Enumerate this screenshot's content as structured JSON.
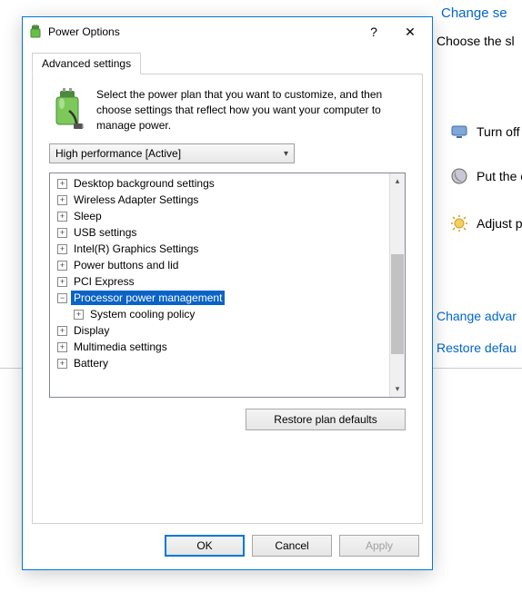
{
  "background": {
    "change_settings_link": "Change se",
    "choose_text": "Choose the sl",
    "actions": {
      "turn_off": "Turn off t",
      "put_computer": "Put the c",
      "adjust": "Adjust pl"
    },
    "links": {
      "change_advanced": "Change advar",
      "restore_default": "Restore defau"
    }
  },
  "dialog": {
    "title": "Power Options",
    "help_symbol": "?",
    "close_symbol": "✕",
    "tab_label": "Advanced settings",
    "description": "Select the power plan that you want to customize, and then choose settings that reflect how you want your computer to manage power.",
    "plan_selected": "High performance [Active]",
    "tree": [
      {
        "level": 1,
        "expand": "+",
        "label": "Desktop background settings",
        "selected": false
      },
      {
        "level": 1,
        "expand": "+",
        "label": "Wireless Adapter Settings",
        "selected": false
      },
      {
        "level": 1,
        "expand": "+",
        "label": "Sleep",
        "selected": false
      },
      {
        "level": 1,
        "expand": "+",
        "label": "USB settings",
        "selected": false
      },
      {
        "level": 1,
        "expand": "+",
        "label": "Intel(R) Graphics Settings",
        "selected": false
      },
      {
        "level": 1,
        "expand": "+",
        "label": "Power buttons and lid",
        "selected": false
      },
      {
        "level": 1,
        "expand": "+",
        "label": "PCI Express",
        "selected": false
      },
      {
        "level": 1,
        "expand": "−",
        "label": "Processor power management",
        "selected": true
      },
      {
        "level": 2,
        "expand": "+",
        "label": "System cooling policy",
        "selected": false
      },
      {
        "level": 1,
        "expand": "+",
        "label": "Display",
        "selected": false
      },
      {
        "level": 1,
        "expand": "+",
        "label": "Multimedia settings",
        "selected": false
      },
      {
        "level": 1,
        "expand": "+",
        "label": "Battery",
        "selected": false
      }
    ],
    "restore_defaults": "Restore plan defaults",
    "buttons": {
      "ok": "OK",
      "cancel": "Cancel",
      "apply": "Apply"
    }
  }
}
